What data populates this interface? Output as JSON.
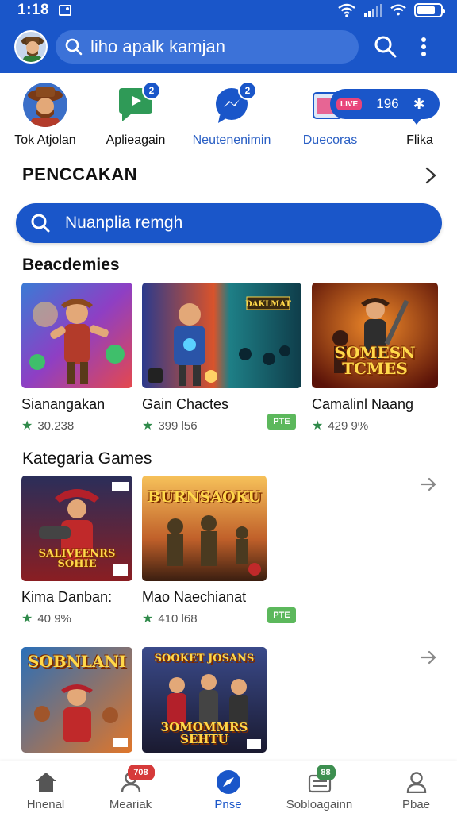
{
  "status_bar": {
    "time": "1:18"
  },
  "header": {
    "search_placeholder": "liho apalk kamjan"
  },
  "quick_items": [
    {
      "label": "Tok Atjolan",
      "badge": ""
    },
    {
      "label": "Aplieagain",
      "badge": "2"
    },
    {
      "label": "Neutenenimin",
      "badge": "2"
    },
    {
      "label": "Duecoras",
      "badge": ""
    },
    {
      "label": "Flika",
      "badge": ""
    }
  ],
  "promo": {
    "tag": "LIVE",
    "count": "196"
  },
  "section_main": {
    "title": "PENCCAKAN"
  },
  "blue_search": {
    "label": "Nuanplia remgh"
  },
  "section1": {
    "title": "Beacdemies",
    "cards": [
      {
        "name": "Sianangakan",
        "rating": "30.238",
        "art_title": ""
      },
      {
        "name": "Gain Chactes",
        "rating": "399 l56",
        "art_title": "DAKLMAT",
        "tag": "PTE"
      },
      {
        "name": "Camalinl Naang",
        "rating": "429 9%",
        "art_title": "SOMESN TCMES"
      }
    ]
  },
  "section2": {
    "title": "Kategaria Games",
    "cards": [
      {
        "name": "Kima Danban:",
        "rating": "40 9%",
        "art_title": "SALIVEENRS SOHIE"
      },
      {
        "name": "Mao Naechianat",
        "rating": "410 l68",
        "art_title": "BURNSAOKU",
        "tag": "PTE"
      }
    ]
  },
  "section3": {
    "cards": [
      {
        "art_title": "SOBNLANI"
      },
      {
        "art_title": "SOOKET JOSANS",
        "art_subtitle": "3OMOMMRS SEHTU"
      }
    ]
  },
  "bottom_nav": [
    {
      "label": "Hnenal",
      "badge": ""
    },
    {
      "label": "Meariak",
      "badge": "708"
    },
    {
      "label": "Pnse",
      "badge": ""
    },
    {
      "label": "Sobloagainn",
      "badge": "88"
    },
    {
      "label": "Pbae",
      "badge": ""
    }
  ],
  "colors": {
    "primary": "#1a56c9",
    "accent_green": "#2f8a4a",
    "badge_red": "#d63a3a"
  }
}
